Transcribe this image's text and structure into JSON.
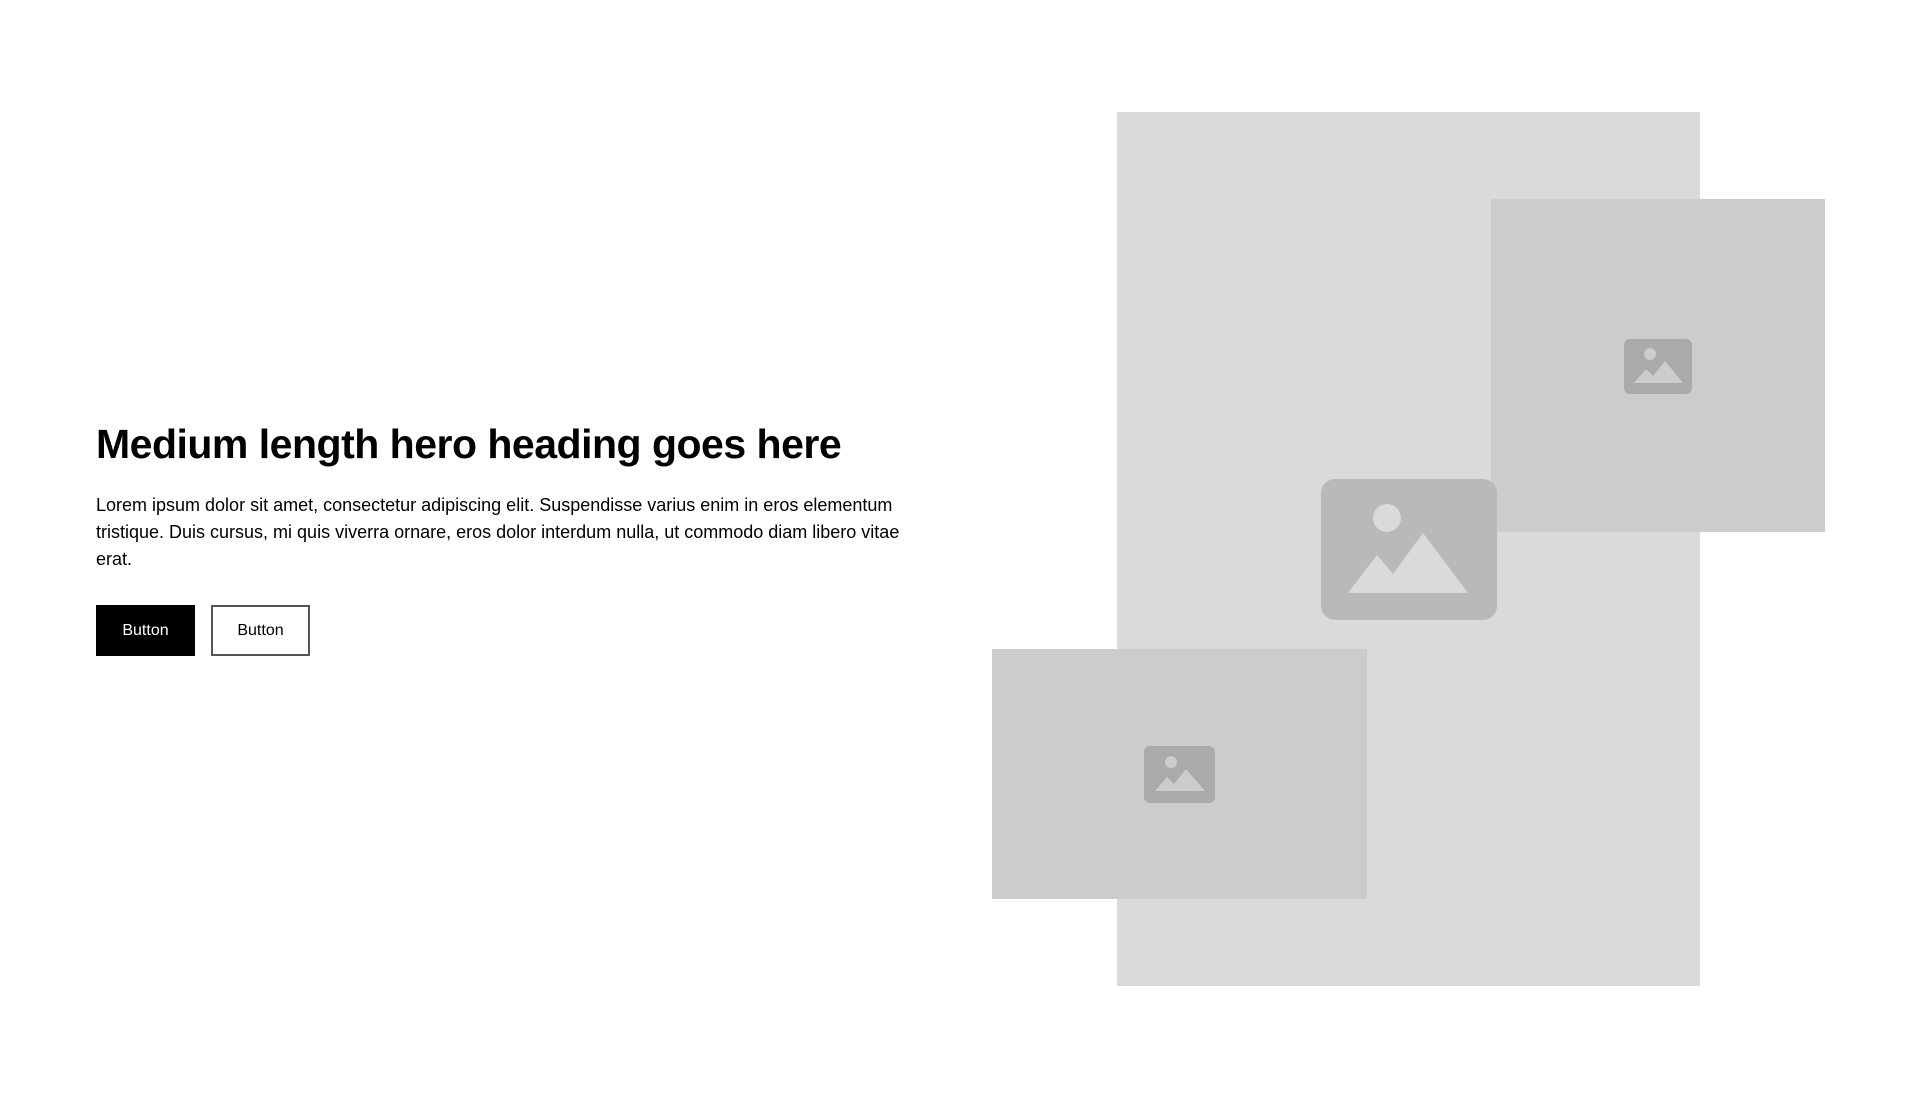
{
  "hero": {
    "heading": "Medium length hero heading goes here",
    "body": "Lorem ipsum dolor sit amet, consectetur adipiscing elit. Suspendisse varius enim in eros elementum tristique. Duis cursus, mi quis viverra ornare, eros dolor interdum nulla, ut commodo diam libero vitae erat.",
    "primary_button_label": "Button",
    "secondary_button_label": "Button"
  },
  "images": {
    "placeholder_icon": "image-icon"
  },
  "colors": {
    "primary_button_bg": "#000000",
    "large_placeholder_bg": "#dadada",
    "small_placeholder_bg": "#cccccc",
    "icon_color": "#aaaaaa",
    "large_icon_color": "#b9b9b9"
  }
}
